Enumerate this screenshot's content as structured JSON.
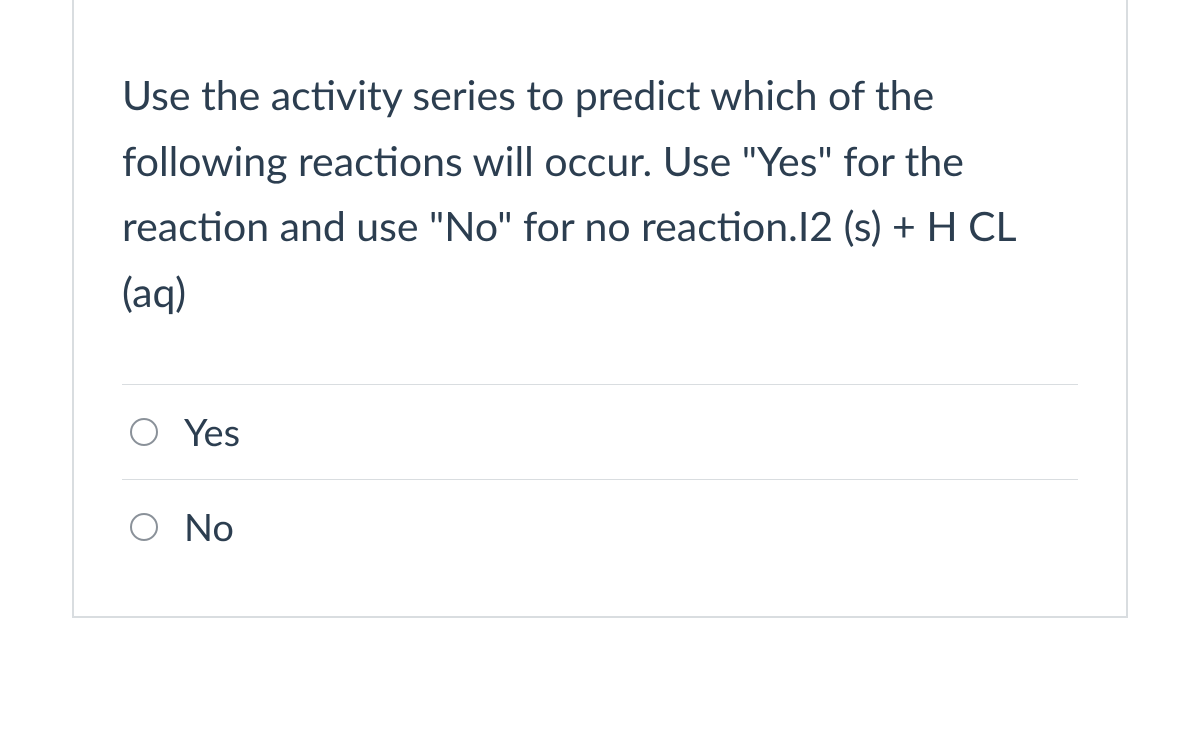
{
  "question": {
    "text": "Use the activity series to predict which of the following reactions will occur. Use \"Yes\" for the reaction and use \"No\" for no reaction.I2 (s) + H CL (aq)"
  },
  "options": [
    {
      "label": "Yes"
    },
    {
      "label": "No"
    }
  ]
}
